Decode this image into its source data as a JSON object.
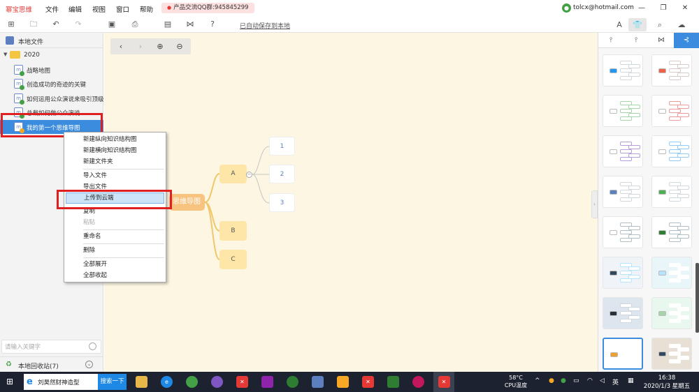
{
  "app": {
    "title": "幂宝思维",
    "menu": [
      "文件",
      "编辑",
      "视图",
      "窗口",
      "帮助"
    ],
    "qq_badge": "产品交流QQ群:945845299",
    "user_email": "tolcx@hotmail.com",
    "window_controls": [
      "minimize-icon",
      "maximize-icon",
      "close-icon"
    ]
  },
  "toolbar": {
    "autosave": "已自动保存到本地",
    "icons": [
      "new-file-icon",
      "open-folder-icon",
      "undo-icon",
      "redo-icon",
      "image-icon",
      "print-icon",
      "note-icon",
      "share-icon",
      "help-icon"
    ],
    "right_tabs": [
      "text-style-icon",
      "theme-shirt-icon",
      "search-icon",
      "cloud-icon"
    ]
  },
  "sidebar": {
    "header": "本地文件",
    "folder": "2020",
    "files": [
      {
        "label": "战略地图",
        "status": "ok"
      },
      {
        "label": "创造成功的奇迹的关键",
        "status": "ok"
      },
      {
        "label": "如何运用公众演说来吸引顶级",
        "status": "ok"
      },
      {
        "label": "总裁如何做公众演说",
        "status": "ok"
      },
      {
        "label": "我的第一个思维导图",
        "status": "warn"
      }
    ],
    "search_placeholder": "请输入关键字",
    "recycle": "本地回收站(7)"
  },
  "context_menu": {
    "items": [
      {
        "label": "新建纵向知识结构图",
        "disabled": false
      },
      {
        "label": "新建横向知识结构图",
        "disabled": false
      },
      {
        "label": "新建文件夹",
        "disabled": false
      },
      {
        "label": "导入文件",
        "disabled": false
      },
      {
        "label": "导出文件",
        "disabled": false
      },
      {
        "label": "上传到云端",
        "disabled": false,
        "highlighted": true
      },
      {
        "label": "复制",
        "disabled": false
      },
      {
        "label": "粘贴",
        "disabled": true
      },
      {
        "label": "重命名",
        "disabled": false
      },
      {
        "label": "删除",
        "disabled": false
      },
      {
        "label": "全部展开",
        "disabled": false
      },
      {
        "label": "全部收起",
        "disabled": false
      }
    ]
  },
  "mindmap": {
    "root": "思维导图",
    "branches": [
      "A",
      "B",
      "C"
    ],
    "leaves": [
      "1",
      "2",
      "3"
    ]
  },
  "right_panel": {
    "layout_tabs": [
      "tree-down-icon",
      "tree-down-alt-icon",
      "mindmap-both-icon",
      "mindmap-right-icon"
    ],
    "theme_hub_colors": [
      "#2196f3",
      "#f06048",
      "#ffffff",
      "#ffffff",
      "#ffffff",
      "#ffffff",
      "#5b7fbf",
      "#4caf50",
      "#ffffff",
      "#2e7d32",
      "#34495e",
      "#b3e5fc",
      "#263238",
      "#a5d6a7",
      "#f0a030",
      "#34495e"
    ],
    "theme_bg_colors": [
      "#ffffff",
      "#ffffff",
      "#ffffff",
      "#ffffff",
      "#ffffff",
      "#ffffff",
      "#ffffff",
      "#ffffff",
      "#ffffff",
      "#ffffff",
      "#f0f4f8",
      "#e8f6fa",
      "#dde6ee",
      "#e8f8ee",
      "#ffffff",
      "#e8e0d4"
    ],
    "theme_branch_colors": [
      "#cfd8dc",
      "#d7ccc8",
      "#a5d6a7",
      "#ef9a9a",
      "#b39ddb",
      "#90caf9",
      "#cfd8dc",
      "#cfd8dc",
      "#b0bec5",
      "#b0bec5",
      "#b3e5fc",
      "#ffffff",
      "#cfd8dc",
      "#ffffff",
      "#ffffff",
      "#ffffff"
    ]
  },
  "taskbar": {
    "search_text": "刘昊然财神造型",
    "search_button": "搜索一下",
    "cpu_temp": "58°C",
    "cpu_label": "CPU温度",
    "ime": "英",
    "time": "16:38",
    "date": "2020/1/3 星期五"
  }
}
